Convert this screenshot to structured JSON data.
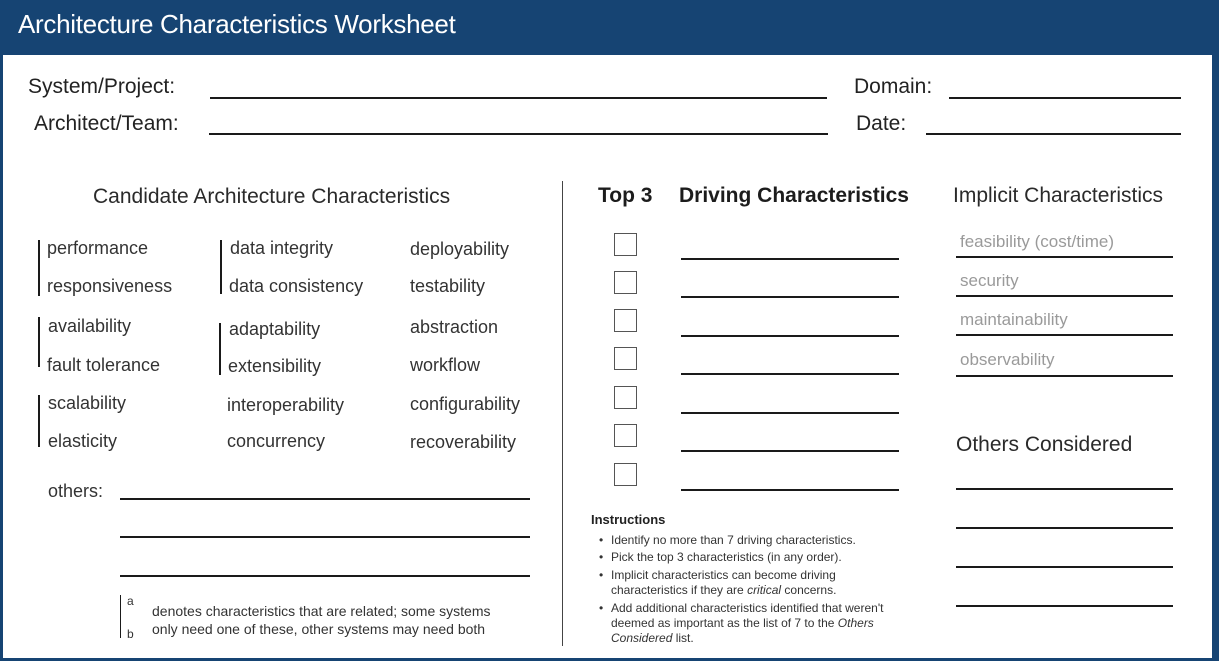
{
  "header": {
    "title": "Architecture Characteristics Worksheet"
  },
  "fields": {
    "system_project": {
      "label": "System/Project:",
      "value": ""
    },
    "architect_team": {
      "label": "Architect/Team:",
      "value": ""
    },
    "domain": {
      "label": "Domain:",
      "value": ""
    },
    "date": {
      "label": "Date:",
      "value": ""
    }
  },
  "candidate": {
    "heading": "Candidate Architecture Characteristics",
    "columns": [
      [
        "performance",
        "responsiveness",
        "availability",
        "fault tolerance",
        "scalability",
        "elasticity"
      ],
      [
        "data integrity",
        "data consistency",
        "adaptability",
        "extensibility",
        "interoperability",
        "concurrency"
      ],
      [
        "deployability",
        "testability",
        "abstraction",
        "workflow",
        "configurability",
        "recoverability"
      ]
    ],
    "others_label": "others:",
    "others_values": [
      "",
      "",
      ""
    ],
    "legend": {
      "letter_a": "a",
      "letter_b": "b",
      "line1": "denotes characteristics that are related; some systems",
      "line2": "only need one of these, other systems may need both"
    }
  },
  "driving": {
    "top3_heading": "Top 3",
    "heading": "Driving Characteristics",
    "rows": [
      {
        "checked": false,
        "value": ""
      },
      {
        "checked": false,
        "value": ""
      },
      {
        "checked": false,
        "value": ""
      },
      {
        "checked": false,
        "value": ""
      },
      {
        "checked": false,
        "value": ""
      },
      {
        "checked": false,
        "value": ""
      },
      {
        "checked": false,
        "value": ""
      }
    ]
  },
  "instructions": {
    "title": "Instructions",
    "items": [
      "Identify no more than 7 driving characteristics.",
      "Pick the top 3 characteristics (in any order).",
      "Implicit characteristics can become driving",
      "characteristics if they are ",
      "critical",
      " concerns.",
      "Add additional characteristics identified that weren't",
      "deemed as important as the list of 7 to the ",
      "Others",
      "Considered",
      " list."
    ]
  },
  "implicit": {
    "heading": "Implicit Characteristics",
    "items": [
      "feasibility (cost/time)",
      "security",
      "maintainability",
      "observability"
    ]
  },
  "others_considered": {
    "heading": "Others Considered",
    "values": [
      "",
      "",
      "",
      ""
    ]
  },
  "colors": {
    "brand": "#164473",
    "implicit_text": "#9a9a9a"
  }
}
